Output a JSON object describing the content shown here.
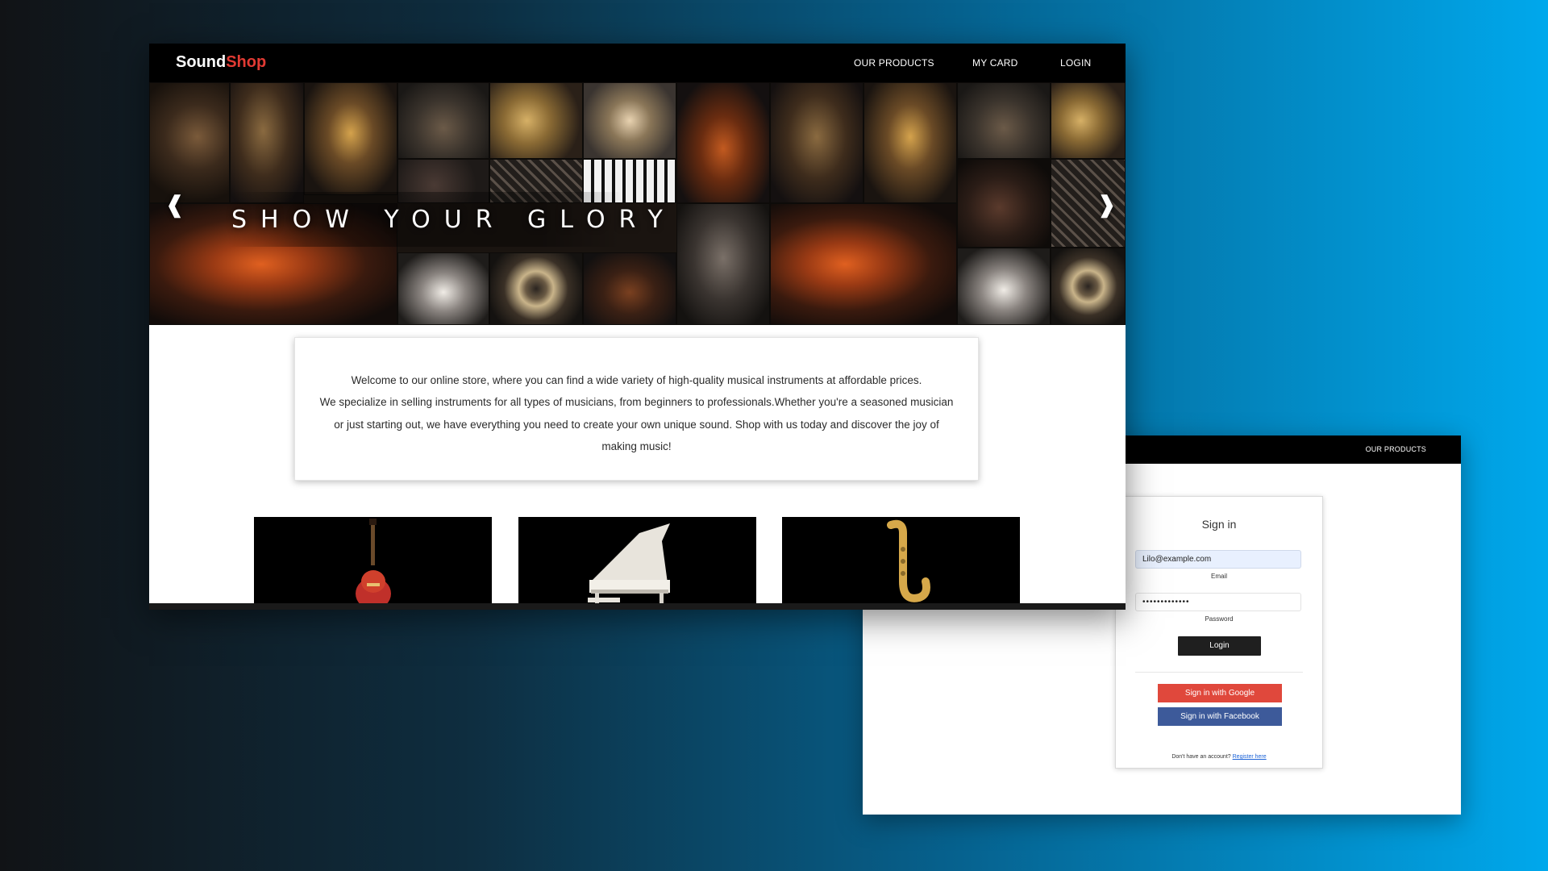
{
  "home": {
    "logo": {
      "part1": "Sound",
      "part2": "Shop"
    },
    "nav": {
      "products": "OUR PRODUCTS",
      "card": "MY CARD",
      "login": "LOGIN"
    },
    "hero": {
      "text": "SHOW YOUR GLORY",
      "prev_arrow": "❰",
      "next_arrow": "❱"
    },
    "welcome": {
      "line1": "Welcome to our online store, where you can find a wide variety of high-quality musical instruments at affordable prices.",
      "line2": "We specialize in selling instruments for all types of musicians, from beginners to professionals.Whether you're a seasoned musician or just starting out, we have everything you need to create your own unique sound. Shop with us today and discover the joy of making music!"
    },
    "products": [
      "electric-guitar",
      "grand-piano",
      "saxophone"
    ]
  },
  "login_page": {
    "nav": {
      "products": "OUR PRODUCTS"
    },
    "title": "Sign in",
    "email": {
      "value": "Lilo@example.com",
      "label": "Email"
    },
    "password": {
      "value": "•••••••••••••",
      "label": "Password"
    },
    "login_button": "Login",
    "google_button": "Sign in with Google",
    "facebook_button": "Sign in with Facebook",
    "register": {
      "prompt": "Don't have an account?",
      "link": "Register here"
    }
  },
  "colors": {
    "brand_red": "#e23a33",
    "google_red": "#e0483c",
    "facebook_blue": "#3d5a9a",
    "link_blue": "#1a61d6"
  }
}
